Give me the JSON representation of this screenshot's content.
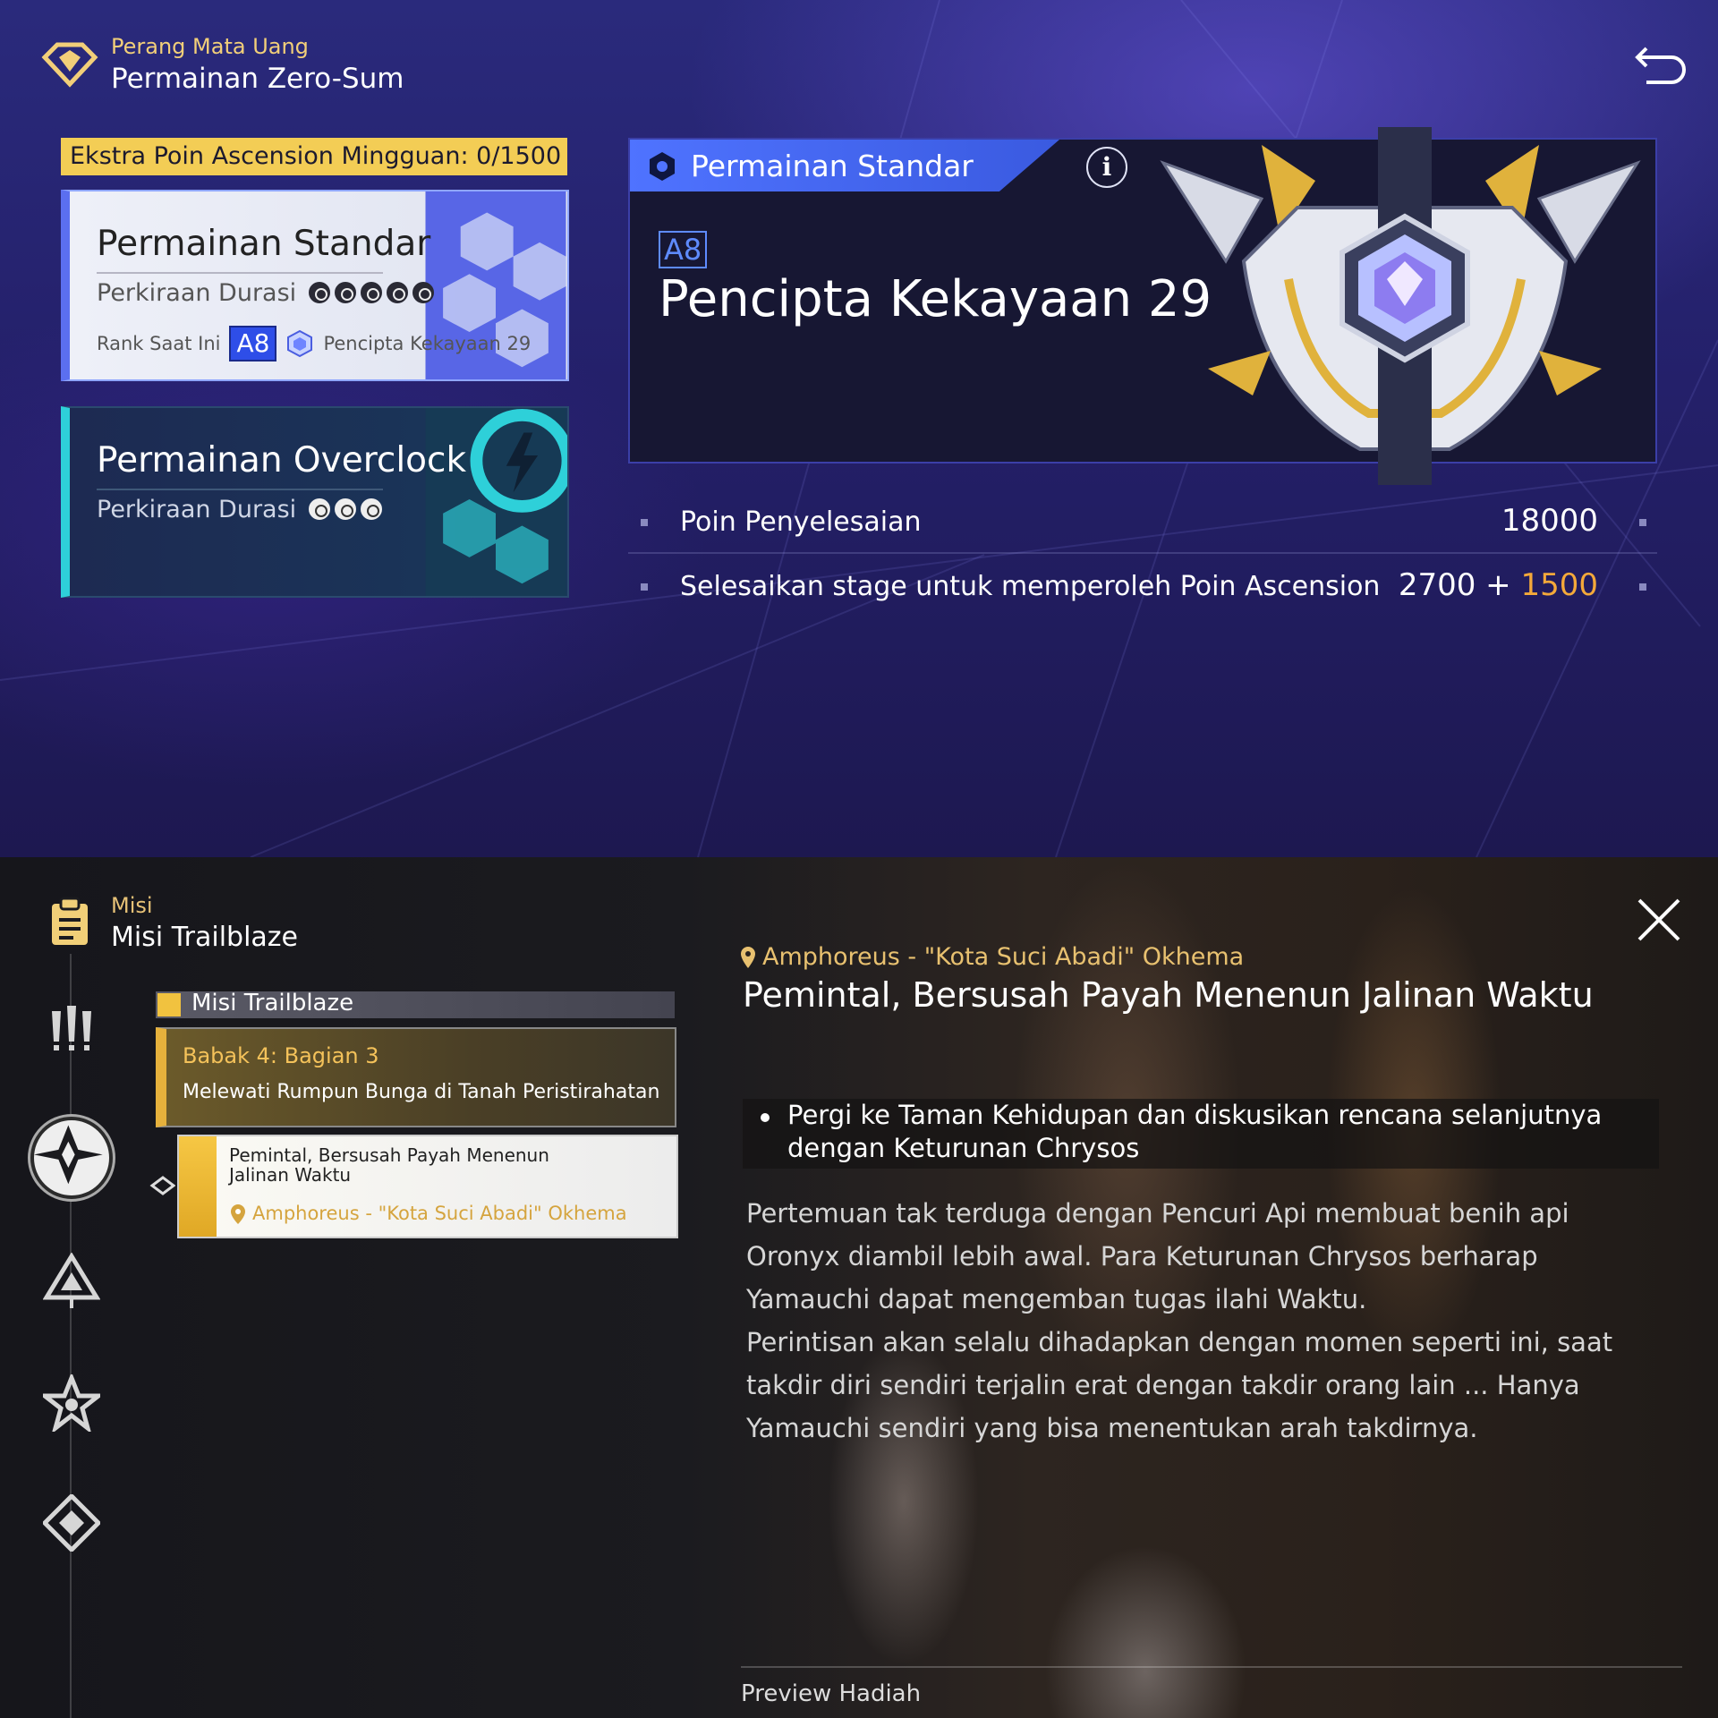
{
  "top": {
    "header": {
      "subtitle": "Perang Mata Uang",
      "title": "Permainan Zero-Sum"
    },
    "weekly_bonus": "Ekstra Poin Ascension Mingguan: 0/1500",
    "modes": [
      {
        "title": "Permainan Standar",
        "duration_label": "Perkiraan Durasi",
        "duration_level": 5,
        "rank_label": "Rank Saat Ini",
        "rank": "A8",
        "rank_name": "Pencipta Kekayaan 29",
        "selected": true
      },
      {
        "title": "Permainan Overclock",
        "duration_label": "Perkiraan Durasi",
        "duration_level": 3,
        "selected": false
      }
    ],
    "detail": {
      "tab_label": "Permainan Standar",
      "info_label": "i",
      "rank": "A8",
      "rank_name": "Pencipta Kekayaan 29"
    },
    "stats": [
      {
        "label": "Poin Penyelesaian",
        "value": "18000"
      },
      {
        "label": "Selesaikan stage untuk memperoleh Poin Ascension",
        "value": "2700 + ",
        "bonus": "1500"
      }
    ],
    "colors": {
      "accent": "#4f73ff",
      "gold": "#f3cd55",
      "bonus": "#f4a93a",
      "teal": "#2ed0d9"
    }
  },
  "bottom": {
    "header": {
      "subtitle": "Misi",
      "title": "Misi Trailblaze"
    },
    "category": "Misi Trailblaze",
    "quest_group": {
      "chapter": "Babak 4: Bagian 3",
      "name": "Melewati Rumpun Bunga di Tanah Peristirahatan"
    },
    "quest_item": {
      "name": "Pemintal, Bersusah Payah Menenun Jalinan Waktu",
      "location": "Amphoreus - \"Kota Suci Abadi\" Okhema"
    },
    "detail": {
      "location": "Amphoreus - \"Kota Suci Abadi\" Okhema",
      "title": "Pemintal, Bersusah Payah Menenun Jalinan Waktu",
      "objective": "Pergi ke Taman Kehidupan dan diskusikan rencana selanjutnya dengan Keturunan Chrysos",
      "description_1": "Pertemuan tak terduga dengan Pencuri Api membuat benih api Oronyx diambil lebih awal. Para Keturunan Chrysos berharap Yamauchi dapat mengemban tugas ilahi Waktu.",
      "description_2": "Perintisan akan selalu dihadapkan dengan momen seperti ini, saat takdir diri sendiri terjalin erat dengan takdir orang lain ... Hanya Yamauchi sendiri yang bisa menentukan arah takdirnya."
    },
    "reward_label": "Preview Hadiah",
    "side_icons": [
      "alert-icon",
      "trailblaze-icon",
      "triangle-icon",
      "star-icon",
      "diamond-icon"
    ]
  }
}
